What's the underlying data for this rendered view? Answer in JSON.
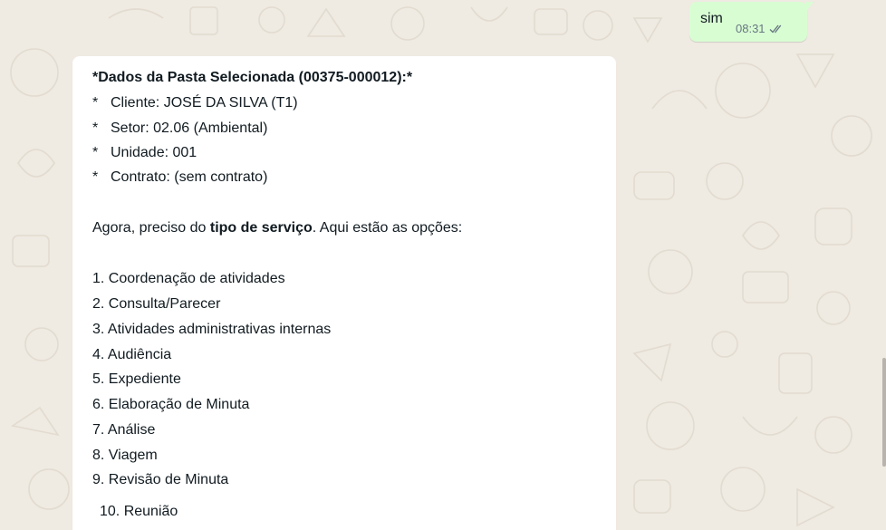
{
  "chat": {
    "outgoing": {
      "text": "sim",
      "time": "08:31",
      "status_icon": "double-check-icon"
    },
    "incoming": {
      "heading": "*Dados da Pasta Selecionada (00375-000012):*",
      "details": [
        {
          "bullet": "*",
          "text": "Cliente: JOSÉ DA SILVA (T1)"
        },
        {
          "bullet": "*",
          "text": "Setor: 02.06 (Ambiental)"
        },
        {
          "bullet": "*",
          "text": "Unidade: 001"
        },
        {
          "bullet": "*",
          "text": "Contrato: (sem contrato)"
        }
      ],
      "prompt_before": "Agora, preciso do ",
      "prompt_bold": "tipo de serviço",
      "prompt_after": ". Aqui estão as opções:",
      "options": [
        "1.  Coordenação de atividades",
        "2.  Consulta/Parecer",
        "3.  Atividades administrativas internas",
        "4.  Audiência",
        "5.  Expediente",
        "6.  Elaboração de Minuta",
        "7.  Análise",
        "8.  Viagem",
        "9.  Revisão de Minuta",
        "10. Reunião"
      ]
    }
  },
  "colors": {
    "background": "#efeae2",
    "outgoing_bubble": "#d9fdd3",
    "incoming_bubble": "#ffffff",
    "meta_text": "#667781",
    "read_receipt": "#667781"
  }
}
